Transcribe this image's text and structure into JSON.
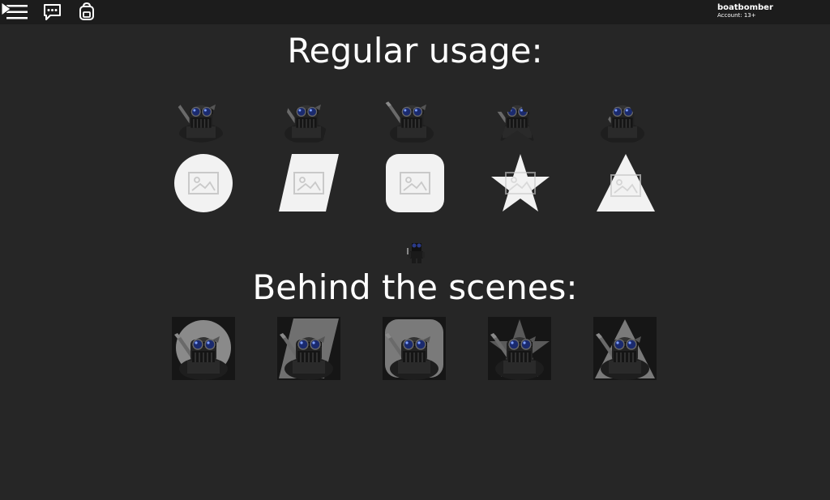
{
  "topbar": {
    "icons": [
      "menu-icon",
      "chat-icon",
      "backpack-icon"
    ],
    "username": "boatbomber",
    "account": "Account: 13+"
  },
  "regular_usage": {
    "title": "Regular usage:",
    "shapes": [
      "circle",
      "parallelogram",
      "rounded-square",
      "star",
      "triangle"
    ]
  },
  "behind_scenes": {
    "title": "Behind the scenes:",
    "shapes": [
      "circle",
      "parallelogram",
      "rounded-square",
      "star",
      "triangle"
    ]
  },
  "colors": {
    "background": "#262626",
    "topbar": "#1c1c1c",
    "mask": "#f2f2f2",
    "text": "#ffffff"
  }
}
